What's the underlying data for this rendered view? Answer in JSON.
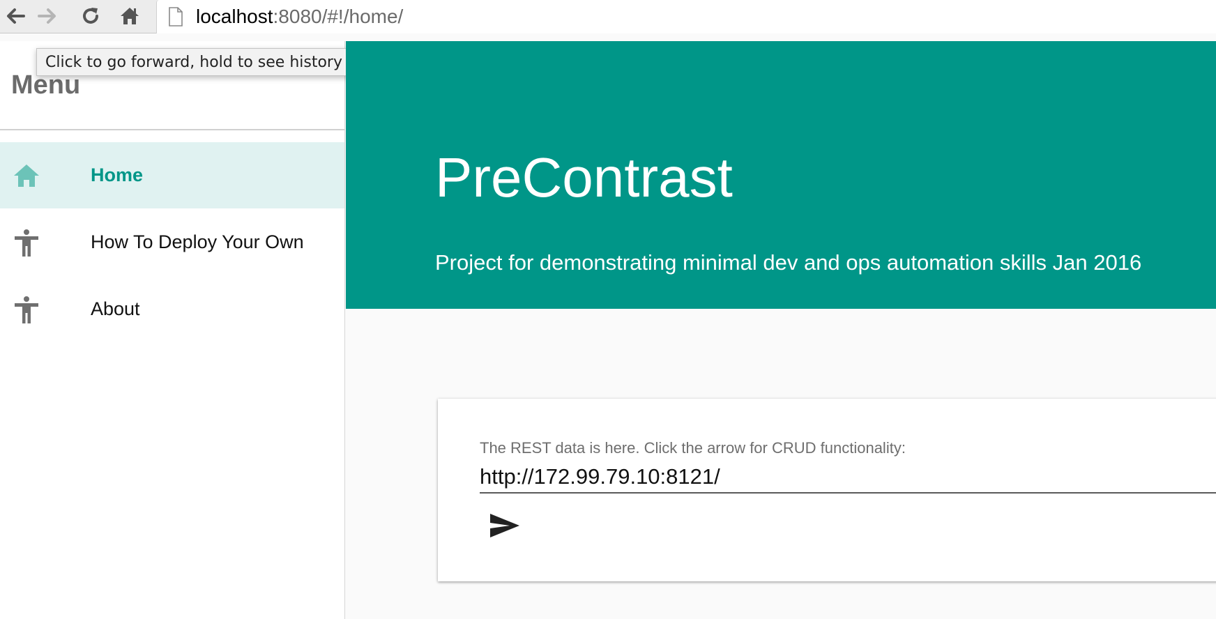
{
  "browser": {
    "url_host": "localhost",
    "url_rest": ":8080/#!/home/",
    "tooltip": "Click to go forward, hold to see history"
  },
  "sidebar": {
    "title": "Menu",
    "items": [
      {
        "label": "Home",
        "icon": "home-icon",
        "active": true
      },
      {
        "label": "How To Deploy Your Own",
        "icon": "accessibility-icon",
        "active": false
      },
      {
        "label": "About",
        "icon": "accessibility-icon",
        "active": false
      }
    ]
  },
  "hero": {
    "title": "PreContrast",
    "subtitle": "Project for demonstrating minimal dev and ops automation skills Jan 2016"
  },
  "card": {
    "label": "The REST data is here. Click the arrow for CRUD functionality:",
    "input_value": "http://172.99.79.10:8121/",
    "send_icon": "send-icon"
  },
  "colors": {
    "accent": "#009688",
    "active_bg": "#e0f2f1",
    "home_icon": "#6cc3b8",
    "gray_icon": "#6f6f6f"
  }
}
